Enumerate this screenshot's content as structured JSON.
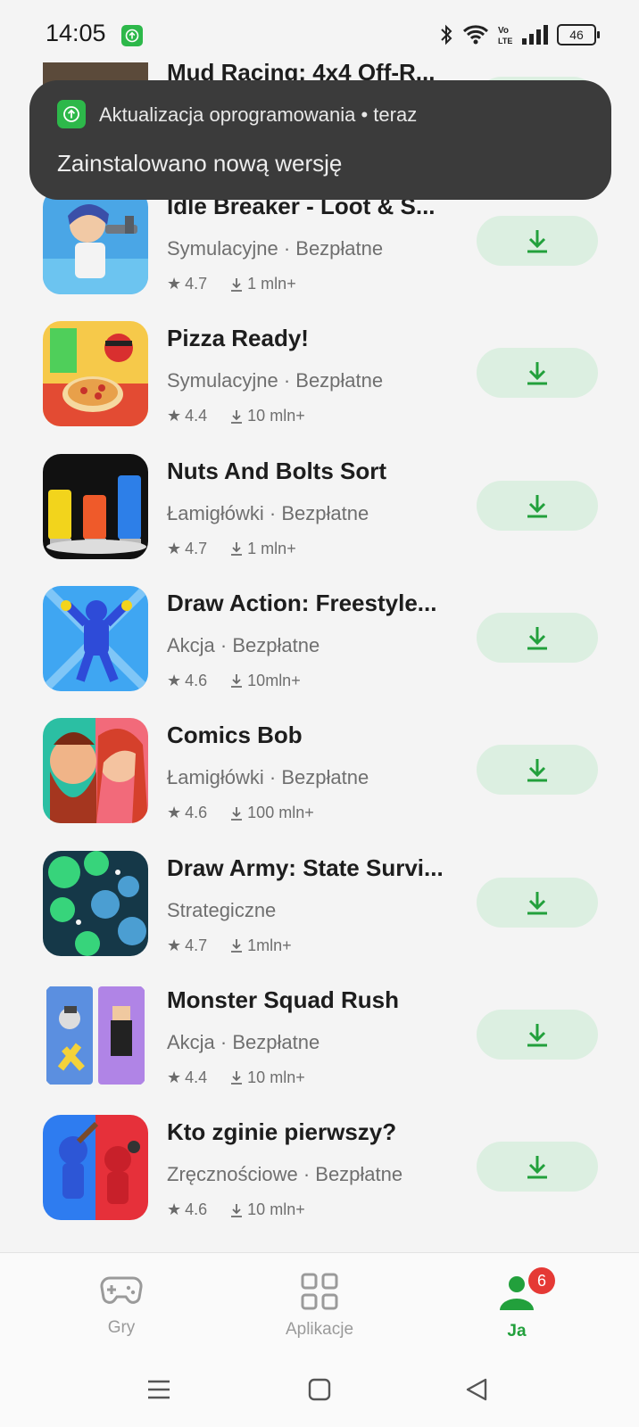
{
  "status_bar": {
    "time": "14:05",
    "battery": "46",
    "icons": [
      "app-update-icon",
      "bluetooth-icon",
      "wifi-icon",
      "volte-icon",
      "signal-icon",
      "battery-icon"
    ]
  },
  "partial_top_item": {
    "title": "Mud Racing: 4x4 Off-R..."
  },
  "notification": {
    "line": "Aktualizacja oprogramowania • teraz",
    "message": "Zainstalowano nową wersję"
  },
  "apps": [
    {
      "title": "Idle Breaker - Loot & S...",
      "category": "Symulacyjne · Bezpłatne",
      "rating": "4.7",
      "downloads": "1 mln+"
    },
    {
      "title": "Pizza Ready!",
      "category": "Symulacyjne · Bezpłatne",
      "rating": "4.4",
      "downloads": "10 mln+"
    },
    {
      "title": "Nuts And Bolts Sort",
      "category": "Łamigłówki · Bezpłatne",
      "rating": "4.7",
      "downloads": "1 mln+"
    },
    {
      "title": "Draw Action: Freestyle...",
      "category": "Akcja · Bezpłatne",
      "rating": "4.6",
      "downloads": "10mln+"
    },
    {
      "title": "Comics Bob",
      "category": "Łamigłówki · Bezpłatne",
      "rating": "4.6",
      "downloads": "100 mln+"
    },
    {
      "title": "Draw Army: State Survi...",
      "category": "Strategiczne",
      "rating": "4.7",
      "downloads": "1mln+"
    },
    {
      "title": "Monster Squad Rush",
      "category": "Akcja · Bezpłatne",
      "rating": "4.4",
      "downloads": "10 mln+"
    },
    {
      "title": "Kto zginie pierwszy?",
      "category": "Zręcznościowe · Bezpłatne",
      "rating": "4.6",
      "downloads": "10 mln+"
    }
  ],
  "bottom_nav": {
    "items": [
      {
        "label": "Gry",
        "icon": "gamepad-icon",
        "active": false
      },
      {
        "label": "Aplikacje",
        "icon": "apps-grid-icon",
        "active": false
      },
      {
        "label": "Ja",
        "icon": "profile-icon",
        "active": true,
        "badge": "6"
      }
    ]
  },
  "colors": {
    "accent": "#22a03c",
    "button_bg": "#dcefe1",
    "toast_bg": "#3b3b3b",
    "badge": "#e53935"
  }
}
